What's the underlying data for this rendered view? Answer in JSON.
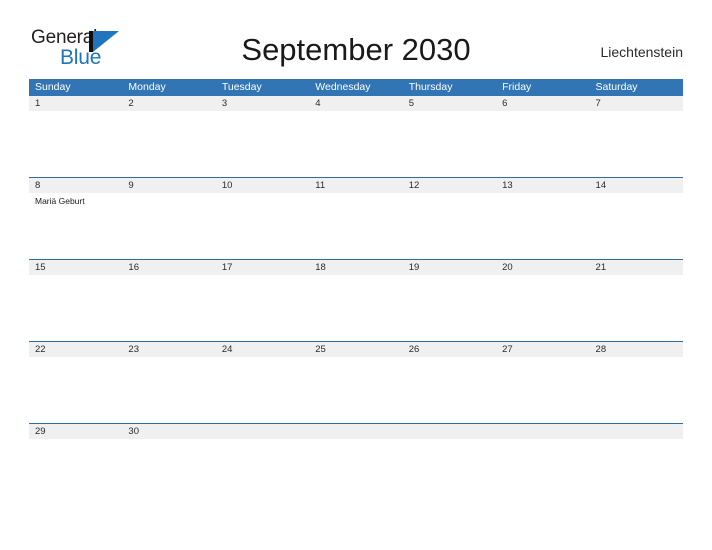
{
  "logo": {
    "word_one": "General",
    "word_two": "Blue",
    "mark": "blue-triangle"
  },
  "header": {
    "title": "September 2030",
    "country": "Liechtenstein"
  },
  "colors": {
    "header_blue": "#3175b5",
    "row_divider_blue": "#2e6da4",
    "date_band_gray": "#f0f0f0",
    "logo_blue": "#1f76bd",
    "text_dark": "#1a1a1a"
  },
  "calendar": {
    "weekdays": [
      "Sunday",
      "Monday",
      "Tuesday",
      "Wednesday",
      "Thursday",
      "Friday",
      "Saturday"
    ],
    "weeks": [
      {
        "days": [
          {
            "date": "1",
            "events": []
          },
          {
            "date": "2",
            "events": []
          },
          {
            "date": "3",
            "events": []
          },
          {
            "date": "4",
            "events": []
          },
          {
            "date": "5",
            "events": []
          },
          {
            "date": "6",
            "events": []
          },
          {
            "date": "7",
            "events": []
          }
        ]
      },
      {
        "days": [
          {
            "date": "8",
            "events": [
              "Mariä Geburt"
            ]
          },
          {
            "date": "9",
            "events": []
          },
          {
            "date": "10",
            "events": []
          },
          {
            "date": "11",
            "events": []
          },
          {
            "date": "12",
            "events": []
          },
          {
            "date": "13",
            "events": []
          },
          {
            "date": "14",
            "events": []
          }
        ]
      },
      {
        "days": [
          {
            "date": "15",
            "events": []
          },
          {
            "date": "16",
            "events": []
          },
          {
            "date": "17",
            "events": []
          },
          {
            "date": "18",
            "events": []
          },
          {
            "date": "19",
            "events": []
          },
          {
            "date": "20",
            "events": []
          },
          {
            "date": "21",
            "events": []
          }
        ]
      },
      {
        "days": [
          {
            "date": "22",
            "events": []
          },
          {
            "date": "23",
            "events": []
          },
          {
            "date": "24",
            "events": []
          },
          {
            "date": "25",
            "events": []
          },
          {
            "date": "26",
            "events": []
          },
          {
            "date": "27",
            "events": []
          },
          {
            "date": "28",
            "events": []
          }
        ]
      },
      {
        "days": [
          {
            "date": "29",
            "events": []
          },
          {
            "date": "30",
            "events": []
          },
          {
            "date": "",
            "events": []
          },
          {
            "date": "",
            "events": []
          },
          {
            "date": "",
            "events": []
          },
          {
            "date": "",
            "events": []
          },
          {
            "date": "",
            "events": []
          }
        ]
      }
    ]
  }
}
